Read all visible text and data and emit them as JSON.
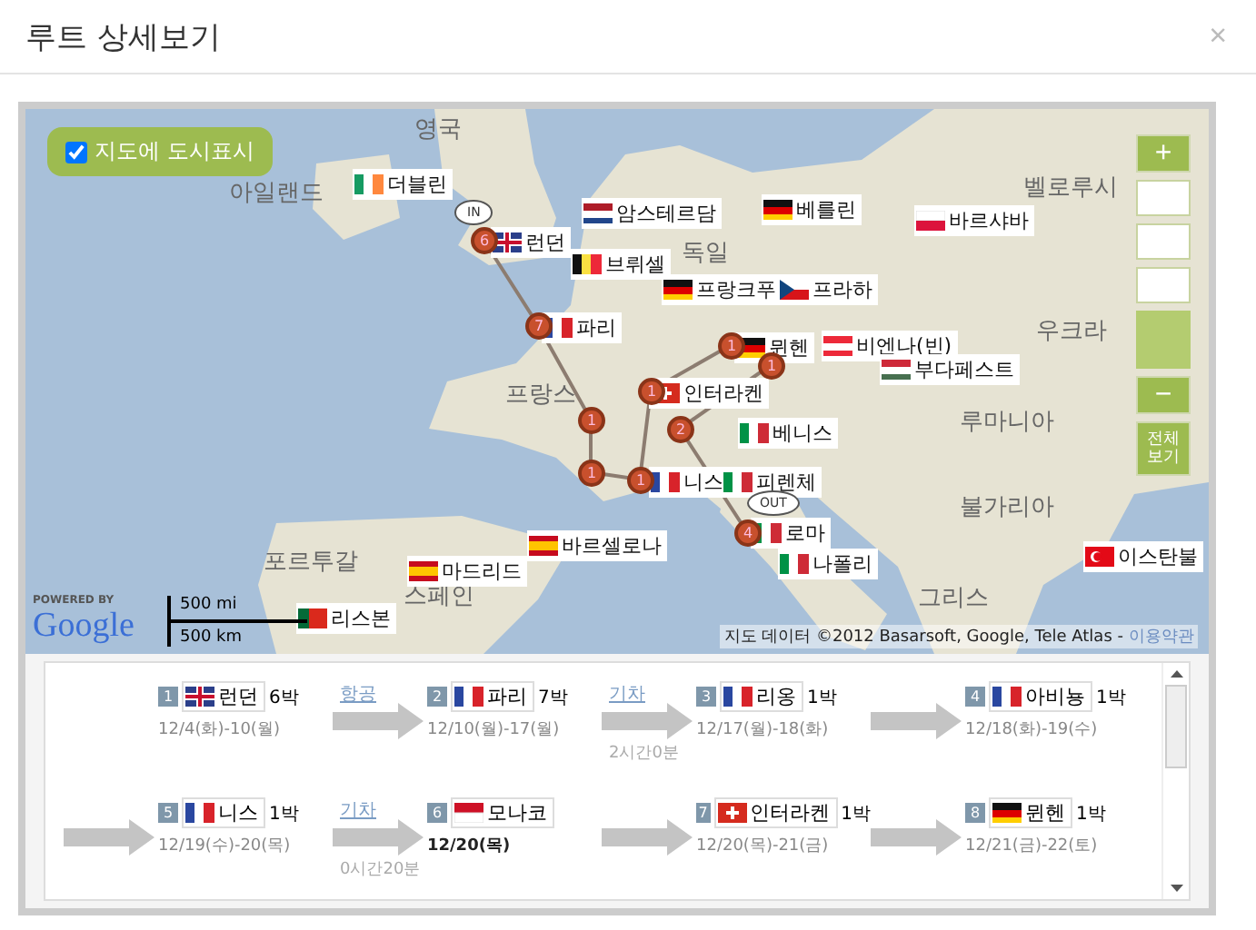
{
  "dialog": {
    "title": "루트 상세보기",
    "close": "×"
  },
  "map": {
    "show_cities": {
      "label": "지도에 도시표시",
      "checked": true
    },
    "countries": [
      "영국",
      "아일랜드",
      "독일",
      "벨로루시",
      "우크라",
      "프랑스",
      "루마니아",
      "불가리아",
      "포르투갈",
      "스페인",
      "그리스"
    ],
    "cities": [
      "더블린",
      "런던",
      "암스테르담",
      "베를린",
      "바르샤바",
      "브뤼셀",
      "프랑크푸",
      "프라하",
      "파리",
      "뮌헨",
      "비엔나(빈)",
      "부다페스트",
      "인터라켄",
      "베니스",
      "니스",
      "피렌체",
      "로마",
      "나폴리",
      "바르셀로나",
      "마드리드",
      "이스탄불",
      "리스본"
    ],
    "markers": [
      "6",
      "7",
      "1",
      "1",
      "1",
      "1",
      "1",
      "1",
      "2",
      "4"
    ],
    "entry": "IN",
    "exit": "OUT",
    "zoom": {
      "in": "+",
      "out": "−",
      "fit": "전체 보기"
    },
    "scale": {
      "miles": "500 mi",
      "km": "500 km"
    },
    "logo": {
      "powered": "POWERED BY",
      "name": "Google"
    },
    "attribution": "지도 데이터 ©2012 Basarsoft, Google, Tele Atlas -",
    "terms": "이용약관"
  },
  "itinerary": [
    {
      "number": "1",
      "name": "런던",
      "nights": "6박",
      "dates": "12/4(화)-10(월)"
    },
    {
      "number": "2",
      "name": "파리",
      "nights": "7박",
      "dates": "12/10(월)-17(월)",
      "transport": {
        "mode": "항공"
      }
    },
    {
      "number": "3",
      "name": "리옹",
      "nights": "1박",
      "dates": "12/17(월)-18(화)",
      "transport": {
        "mode": "기차",
        "duration": "2시간0분"
      }
    },
    {
      "number": "4",
      "name": "아비뇽",
      "nights": "1박",
      "dates": "12/18(화)-19(수)"
    },
    {
      "number": "5",
      "name": "니스",
      "nights": "1박",
      "dates": "12/19(수)-20(목)"
    },
    {
      "number": "6",
      "name": "모나코",
      "dates": "12/20(목)",
      "transport": {
        "mode": "기차",
        "duration": "0시간20분"
      }
    },
    {
      "number": "7",
      "name": "인터라켄",
      "nights": "1박",
      "dates": "12/20(목)-21(금)"
    },
    {
      "number": "8",
      "name": "뮌헨",
      "nights": "1박",
      "dates": "12/21(금)-22(토)"
    }
  ]
}
